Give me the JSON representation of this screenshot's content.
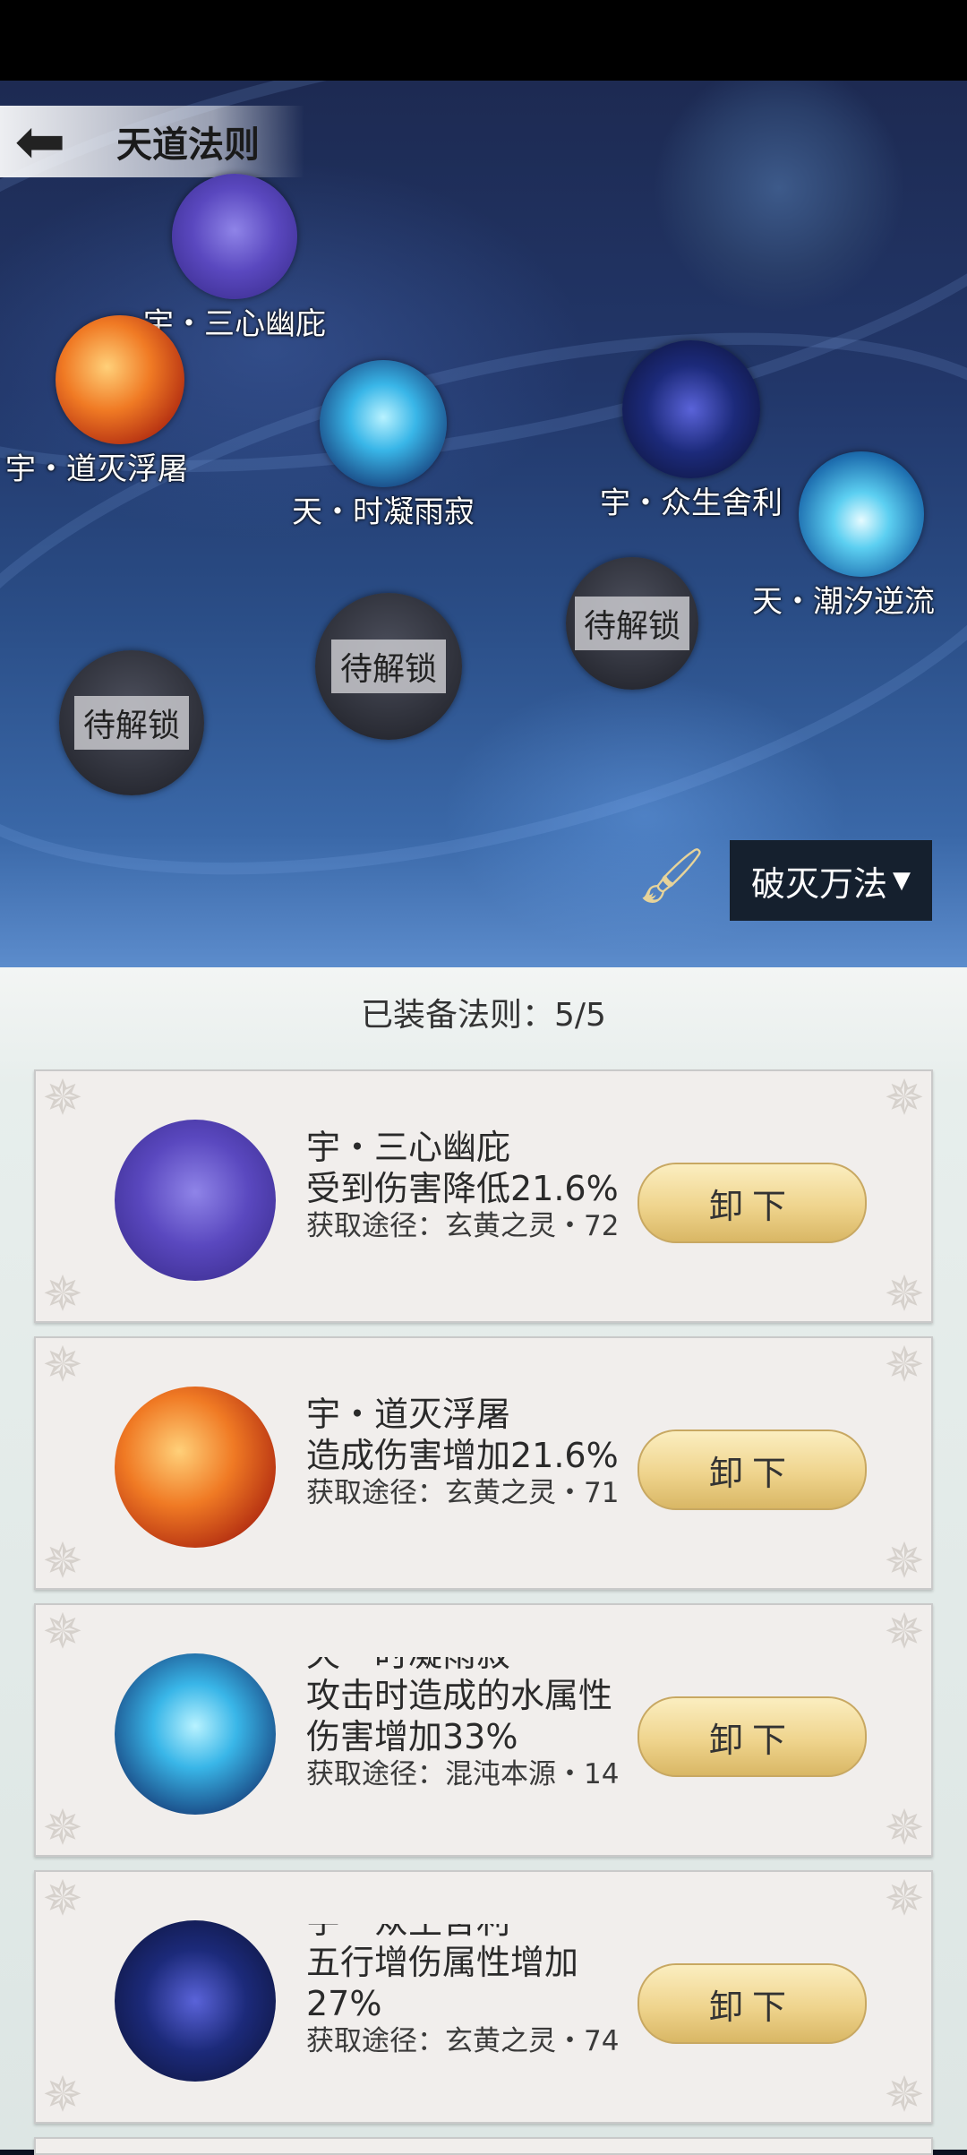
{
  "header": {
    "title": "天道法则"
  },
  "map_nodes": [
    {
      "label": "宇・三心幽庇",
      "icon": "shield-icon"
    },
    {
      "label": "宇・道灭浮屠",
      "icon": "fire-blade-icon"
    },
    {
      "label": "天・时凝雨寂",
      "icon": "water-drop-icon"
    },
    {
      "label": "宇・众生舍利",
      "icon": "spirit-orbs-icon"
    },
    {
      "label": "天・潮汐逆流",
      "icon": "tide-icon"
    }
  ],
  "locked_nodes": [
    "待解锁",
    "待解锁",
    "待解锁"
  ],
  "filter_dropdown": {
    "value": "破灭万法"
  },
  "equipped": {
    "header": "已装备法则：5/5"
  },
  "cards": [
    {
      "name": "宇・三心幽庇",
      "effect": "受到伤害降低21.6%",
      "source": "获取途径：玄黄之灵・72",
      "button": "卸下"
    },
    {
      "name": "宇・道灭浮屠",
      "effect": "造成伤害增加21.6%",
      "source": "获取途径：玄黄之灵・71",
      "button": "卸下"
    },
    {
      "name": "天・时凝雨寂",
      "effect": "攻击时造成的水属性伤害增加33%",
      "source": "获取途径：混沌本源・14",
      "button": "卸下"
    },
    {
      "name": "宇・众生舍利",
      "effect": "五行增伤属性增加27%",
      "source": "获取途径：玄黄之灵・74",
      "button": "卸下"
    }
  ]
}
